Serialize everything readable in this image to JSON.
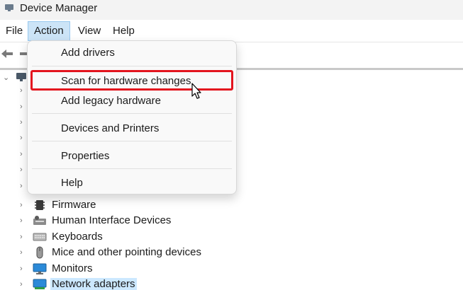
{
  "window": {
    "title": "Device Manager"
  },
  "menubar": {
    "items": [
      "File",
      "Action",
      "View",
      "Help"
    ]
  },
  "action_menu": {
    "items": [
      "Add drivers",
      "Scan for hardware changes",
      "Add legacy hardware",
      "Devices and Printers",
      "Properties",
      "Help"
    ],
    "highlighted_item": "Scan for hardware changes"
  },
  "tree": {
    "visible_items": [
      "Firmware",
      "Human Interface Devices",
      "Keyboards",
      "Mice and other pointing devices",
      "Monitors",
      "Network adapters"
    ],
    "selected_item": "Network adapters"
  },
  "colors": {
    "highlight_border": "#e3141e",
    "menu_active": "#cce4f7",
    "selection": "#cce8ff"
  }
}
